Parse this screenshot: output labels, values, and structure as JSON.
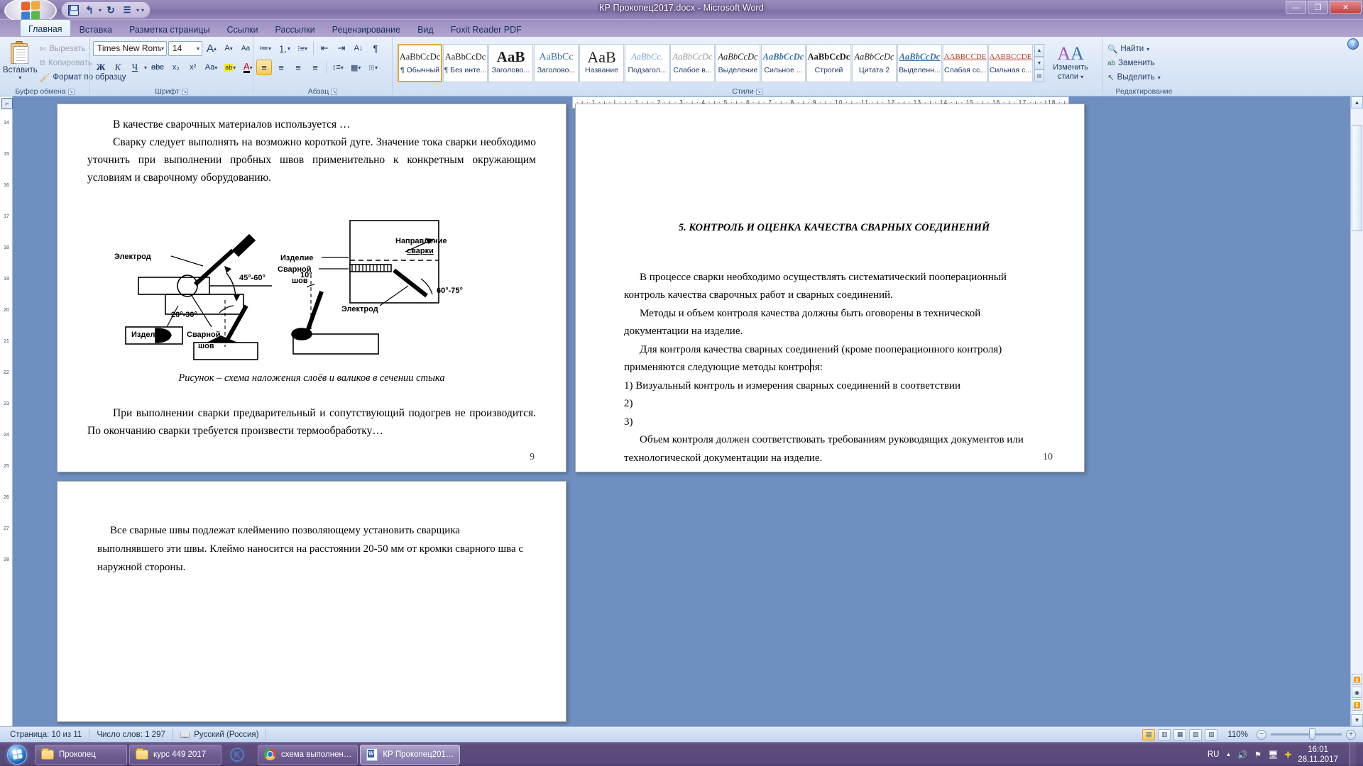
{
  "window": {
    "title": "КР Прокопец2017.docx - Microsoft Word",
    "minimize": "—",
    "maximize": "❐",
    "close": "✕",
    "office_button": "office-logo"
  },
  "quick_access": {
    "save": "save-icon",
    "undo": "↰",
    "redo": "↻",
    "quickprint": "list-icon",
    "customize": "▾"
  },
  "ribbon": {
    "tabs": [
      {
        "label": "Главная",
        "active": true
      },
      {
        "label": "Вставка",
        "active": false
      },
      {
        "label": "Разметка страницы",
        "active": false
      },
      {
        "label": "Ссылки",
        "active": false
      },
      {
        "label": "Рассылки",
        "active": false
      },
      {
        "label": "Рецензирование",
        "active": false
      },
      {
        "label": "Вид",
        "active": false
      },
      {
        "label": "Foxit Reader PDF",
        "active": false
      }
    ],
    "help_label": "?",
    "groups": {
      "clipboard": {
        "label": "Буфер обмена",
        "paste": "Вставить",
        "cut": "Вырезать",
        "copy": "Копировать",
        "format_painter": "Формат по образцу"
      },
      "font": {
        "label": "Шрифт",
        "font_name": "Times New Roman",
        "font_size": "14",
        "grow": "A",
        "shrink": "A",
        "clear_format": "Aa",
        "bold": "Ж",
        "italic": "К",
        "underline": "Ч",
        "strikethrough": "abc",
        "subscript": "x₂",
        "superscript": "x²",
        "change_case": "Aa",
        "highlight": "ab",
        "font_color": "A"
      },
      "paragraph": {
        "label": "Абзац",
        "bullets": "≔",
        "numbering": "⒈",
        "multilevel": "⁝≡",
        "decrease_indent": "⇤",
        "increase_indent": "⇥",
        "sort": "A↓",
        "show_marks": "¶",
        "align_left": "≡",
        "align_center": "≡",
        "align_right": "≡",
        "justify": "≡",
        "line_spacing": "↕≡",
        "shading": "▦",
        "borders": "⊞"
      },
      "styles": {
        "label": "Стили",
        "items": [
          {
            "sample": "AaBbCcDc",
            "name": "¶ Обычный",
            "selected": true
          },
          {
            "sample": "AaBbCcDc",
            "name": "¶ Без инте...",
            "selected": false
          },
          {
            "sample": "AaB",
            "name": "Заголово...",
            "selected": false
          },
          {
            "sample": "AaBbCc",
            "name": "Заголово...",
            "selected": false
          },
          {
            "sample": "AaB",
            "name": "Название",
            "selected": false
          },
          {
            "sample": "AaBbCc.",
            "name": "Подзагол...",
            "selected": false
          },
          {
            "sample": "AaBbCcDc",
            "name": "Слабое в...",
            "selected": false
          },
          {
            "sample": "AaBbCcDc",
            "name": "Выделение",
            "selected": false
          },
          {
            "sample": "AaBbCcDc",
            "name": "Сильное ...",
            "selected": false
          },
          {
            "sample": "AaBbCcDc",
            "name": "Строгий",
            "selected": false
          },
          {
            "sample": "AaBbCcDc",
            "name": "Цитата 2",
            "selected": false
          },
          {
            "sample": "AaBbCcDc",
            "name": "Выделенн...",
            "selected": false
          },
          {
            "sample": "AABBCCDE",
            "name": "Слабая сс...",
            "selected": false
          },
          {
            "sample": "AABBCCDE",
            "name": "Сильная с...",
            "selected": false
          }
        ],
        "scroll_up": "▲",
        "scroll_down": "▼",
        "more": "▤",
        "change_styles": "Изменить стили"
      },
      "editing": {
        "label": "Редактирование",
        "find": "Найти",
        "replace": "Заменить",
        "select": "Выделить"
      }
    }
  },
  "rulers": {
    "vertical_ticks": [
      "14",
      "15",
      "16",
      "17",
      "18",
      "19",
      "20",
      "21",
      "22",
      "23",
      "24",
      "25",
      "26",
      "27",
      "28"
    ],
    "horizontal_text": "2 · ı · 1 · ı · ȴ · ı · 1 · ı · 2 · ı · 3 · ı · 4 · ı · 5 · ı · 6 · ı · 7 · ı · 8 · ı · 9 · ı · 10 · ı · 11 · ı · 12 · ı · 13 · ı · 14 · ı · 15 · ı · 16 · ı · 17 · ı · ȴ18 · ı ·",
    "tab_selector": "⌐"
  },
  "document": {
    "page1": {
      "paragraphs": [
        "В качестве сварочных материалов используется …",
        "Сварку следует выполнять на возможно короткой дуге. Значение тока сварки необходимо уточнить при выполнении пробных швов применительно к конкретным окружающим условиям и сварочному оборудованию.",
        "При выполнении сварки предварительный и сопутствующий подогрев не производится. По окончанию сварки требуется произвести термообработку…"
      ],
      "figure_caption": "Рисунок – схема наложения слоёв и валиков в сечении стыка",
      "figure_labels": {
        "electrode": "Электрод",
        "angle1": "45°-60°",
        "workpiece": "Изделие",
        "weld_seam_1": "Сварной",
        "weld_seam_2": "шов",
        "direction_1": "Направление",
        "direction_2": "сварки",
        "workpiece2": "Изделие",
        "seam2_a": "Сварной",
        "seam2_b": "шов",
        "electrode2": "Электрод",
        "angle2": "60°-75°",
        "angle3": "10°",
        "angle4": "20°-30°"
      },
      "page_number": "9"
    },
    "page2": {
      "heading": "5. КОНТРОЛЬ И ОЦЕНКА КАЧЕСТВА СВАРНЫХ СОЕДИНЕНИЙ",
      "paragraphs": [
        "В процессе сварки необходимо осуществлять систематический пооперационный контроль качества сварочных работ и сварных соединений.",
        "Методы и объем контроля качества должны быть оговорены в технической документации на изделие.",
        "Для контроля качества сварных соединений (кроме пооперационного контроля) применяются следующие методы контроля:"
      ],
      "list": [
        "1) Визуальный контроль и измерения сварных соединений в соответствии",
        "2)",
        "3)"
      ],
      "closing": "Объем контроля должен соответствовать требованиям руководящих документов или технологической документации на изделие.",
      "page_number": "10"
    },
    "page3": {
      "paragraphs": [
        "Все сварные швы подлежат клеймению позволяющему установить сварщика выполнявшего эти швы. Клеймо наносится на расстоянии 20-50 мм от кромки сварного шва с наружной стороны."
      ]
    }
  },
  "status_bar": {
    "page": "Страница: 10 из 11",
    "words": "Число слов: 1 297",
    "proofing_icon": "spellcheck-icon",
    "language": "Русский (Россия)",
    "views": [
      {
        "name": "print-layout",
        "glyph": "▤",
        "active": true
      },
      {
        "name": "full-screen-reading",
        "glyph": "▥",
        "active": false
      },
      {
        "name": "web-layout",
        "glyph": "▦",
        "active": false
      },
      {
        "name": "outline",
        "glyph": "▧",
        "active": false
      },
      {
        "name": "draft",
        "glyph": "▨",
        "active": false
      }
    ],
    "zoom": "110%",
    "zoom_out": "−",
    "zoom_in": "+"
  },
  "taskbar": {
    "start": "start-orb",
    "items": [
      {
        "label": "Прокопец",
        "icon": "folder-icon",
        "active": false,
        "frame": true
      },
      {
        "label": "курс 449 2017",
        "icon": "folder-icon",
        "active": false,
        "frame": true
      },
      {
        "label": "",
        "icon": "kompas-icon",
        "active": false,
        "frame": false
      },
      {
        "label": "схема выполнен…",
        "icon": "chrome-icon",
        "active": false,
        "frame": true
      },
      {
        "label": "КР Прокопец201…",
        "icon": "word-icon",
        "active": true,
        "frame": true
      }
    ],
    "tray": {
      "language": "RU",
      "show_hidden": "▲",
      "volume": "volume-icon",
      "network": "network-icon",
      "action_center": "monitor-icon",
      "updates": "update-icon",
      "time": "16:01",
      "date": "28.11.2017"
    }
  }
}
